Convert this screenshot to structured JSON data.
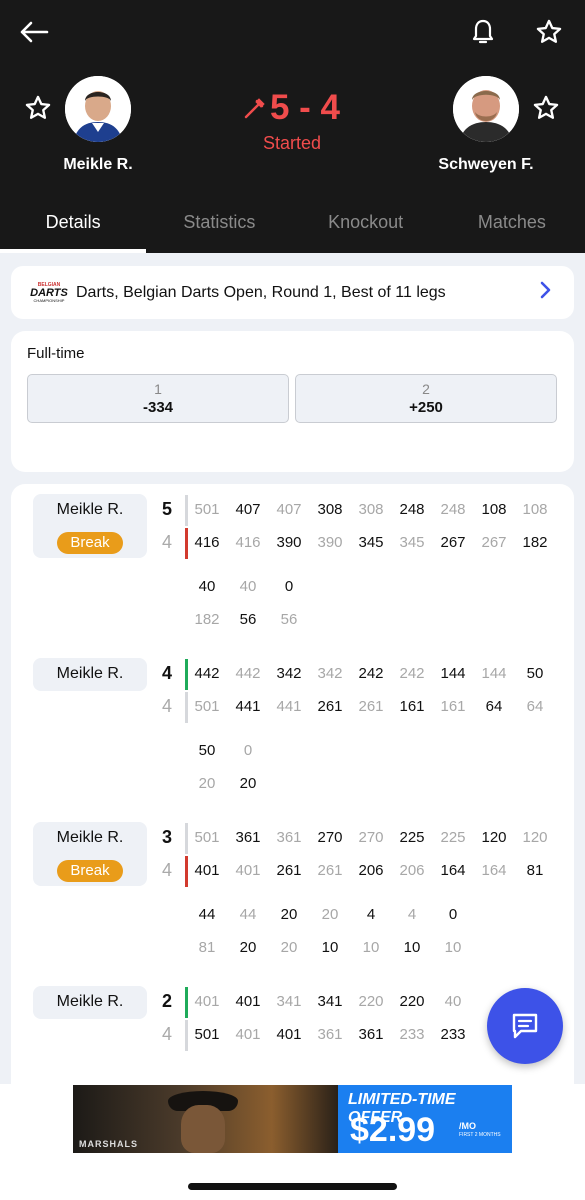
{
  "header": {
    "score": "5 - 4",
    "status": "Started",
    "player_left": "Meikle R.",
    "player_right": "Schweyen F.",
    "icons": {
      "back": "back-arrow-icon",
      "bell": "bell-icon",
      "favorite": "star-icon",
      "score_icon": "dart-icon"
    }
  },
  "tabs": [
    {
      "label": "Details",
      "active": true
    },
    {
      "label": "Statistics",
      "active": false
    },
    {
      "label": "Knockout",
      "active": false
    },
    {
      "label": "Matches",
      "active": false
    }
  ],
  "tournament": {
    "logo_line1": "BELGIAN",
    "logo_line2": "DARTS",
    "logo_line3": "CHAMPIONSHIP",
    "text": "Darts, Belgian Darts Open, Round 1, Best of 11 legs"
  },
  "odds": {
    "title": "Full-time",
    "options": [
      {
        "name": "1",
        "value": "-334"
      },
      {
        "name": "2",
        "value": "+250"
      }
    ]
  },
  "legs": [
    {
      "winner": "Meikle R.",
      "break": "Break",
      "top_score": "5",
      "bottom_score": "4",
      "top_bold": true,
      "bar_color": "#d23a2e",
      "bar_row": "bottom",
      "row1": [
        "501",
        "407",
        "407",
        "308",
        "308",
        "248",
        "248",
        "108",
        "108"
      ],
      "row2": [
        "416",
        "416",
        "390",
        "390",
        "345",
        "345",
        "267",
        "267",
        "182"
      ],
      "row3": [
        "40",
        "40",
        "0"
      ],
      "row4": [
        "182",
        "56",
        "56"
      ]
    },
    {
      "winner": "Meikle R.",
      "break": "",
      "top_score": "4",
      "bottom_score": "4",
      "top_bold": true,
      "bar_color": "#1fab5a",
      "bar_row": "top",
      "row1": [
        "442",
        "442",
        "342",
        "342",
        "242",
        "242",
        "144",
        "144",
        "50"
      ],
      "row2": [
        "501",
        "441",
        "441",
        "261",
        "261",
        "161",
        "161",
        "64",
        "64"
      ],
      "row3": [
        "50",
        "0"
      ],
      "row4": [
        "20",
        "20"
      ]
    },
    {
      "winner": "Meikle R.",
      "break": "Break",
      "top_score": "3",
      "bottom_score": "4",
      "top_bold": true,
      "bar_color": "#d23a2e",
      "bar_row": "bottom",
      "row1": [
        "501",
        "361",
        "361",
        "270",
        "270",
        "225",
        "225",
        "120",
        "120"
      ],
      "row2": [
        "401",
        "401",
        "261",
        "261",
        "206",
        "206",
        "164",
        "164",
        "81"
      ],
      "row3": [
        "44",
        "44",
        "20",
        "20",
        "4",
        "4",
        "0"
      ],
      "row4": [
        "81",
        "20",
        "20",
        "10",
        "10",
        "10",
        "10"
      ]
    },
    {
      "winner": "Meikle R.",
      "break": "",
      "top_score": "2",
      "bottom_score": "4",
      "top_bold": true,
      "bar_color": "#1fab5a",
      "bar_row": "top",
      "row1": [
        "401",
        "401",
        "341",
        "341",
        "220",
        "220",
        "40"
      ],
      "row2": [
        "501",
        "401",
        "401",
        "361",
        "361",
        "233",
        "233"
      ],
      "row3": [],
      "row4": []
    }
  ],
  "chat_icon": "chat-icon",
  "ad": {
    "brand": "MARSHALS",
    "offer": "LIMITED-TIME OFFER",
    "price": "$2.99",
    "per": "/MO",
    "fine_print": "FIRST 2 MONTHS"
  }
}
